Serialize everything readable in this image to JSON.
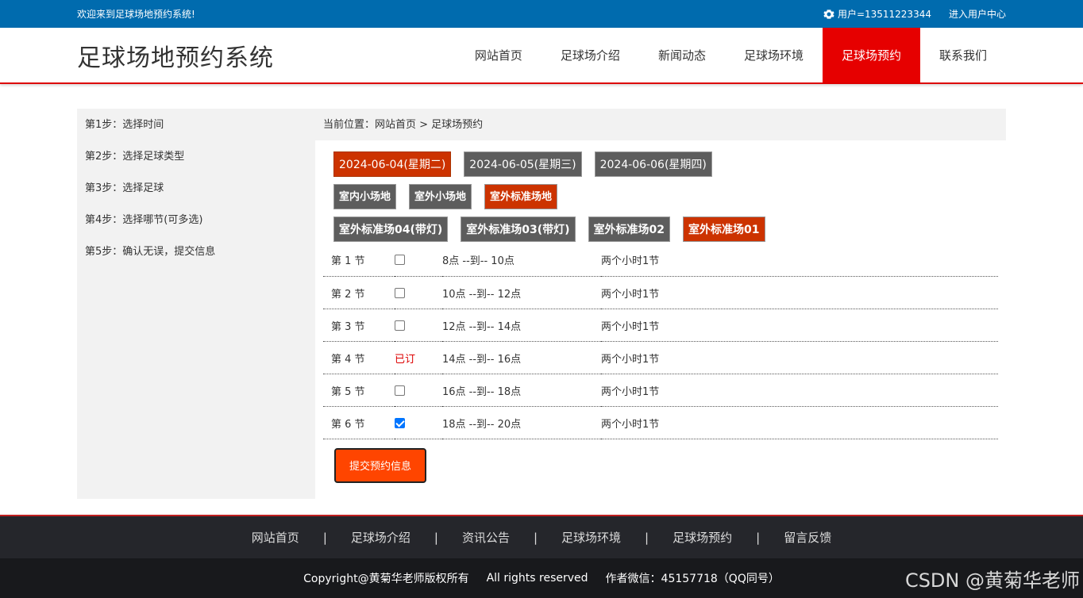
{
  "topbar": {
    "welcome": "欢迎来到足球场地预约系统!",
    "user": "用户=13511223344",
    "user_center": "进入用户中心"
  },
  "header": {
    "logo": "足球场地预约系统",
    "nav": [
      "网站首页",
      "足球场介绍",
      "新闻动态",
      "足球场环境",
      "足球场预约",
      "联系我们"
    ],
    "active_index": 4
  },
  "sidebar": {
    "steps": [
      "第1步：选择时间",
      "第2步：选择足球类型",
      "第3步：选择足球",
      "第4步：选择哪节(可多选)",
      "第5步：确认无误，提交信息"
    ]
  },
  "breadcrumb": "当前位置：网站首页 > 足球场预约",
  "dates": [
    {
      "label": "2024-06-04(星期二)",
      "selected": true
    },
    {
      "label": "2024-06-05(星期三)",
      "selected": false
    },
    {
      "label": "2024-06-06(星期四)",
      "selected": false
    }
  ],
  "types": [
    {
      "label": "室内小场地",
      "selected": false
    },
    {
      "label": "室外小场地",
      "selected": false
    },
    {
      "label": "室外标准场地",
      "selected": true
    }
  ],
  "fields": [
    {
      "label": "室外标准场04(带灯)",
      "selected": false
    },
    {
      "label": "室外标准场03(带灯)",
      "selected": false
    },
    {
      "label": "室外标准场02",
      "selected": false
    },
    {
      "label": "室外标准场01",
      "selected": true
    }
  ],
  "slots": [
    {
      "period": "第 1 节",
      "status": "checkbox",
      "checked": false,
      "time": "8点 --到-- 10点",
      "duration": "两个小时1节"
    },
    {
      "period": "第 2 节",
      "status": "checkbox",
      "checked": false,
      "time": "10点 --到-- 12点",
      "duration": "两个小时1节"
    },
    {
      "period": "第 3 节",
      "status": "checkbox",
      "checked": false,
      "time": "12点 --到-- 14点",
      "duration": "两个小时1节"
    },
    {
      "period": "第 4 节",
      "status": "booked",
      "booked_text": "已订",
      "time": "14点 --到-- 16点",
      "duration": "两个小时1节"
    },
    {
      "period": "第 5 节",
      "status": "checkbox",
      "checked": false,
      "time": "16点 --到-- 18点",
      "duration": "两个小时1节"
    },
    {
      "period": "第 6 节",
      "status": "checkbox",
      "checked": true,
      "time": "18点 --到-- 20点",
      "duration": "两个小时1节"
    }
  ],
  "submit_label": "提交预约信息",
  "footer": {
    "nav": [
      "网站首页",
      "足球场介绍",
      "资讯公告",
      "足球场环境",
      "足球场预约",
      "留言反馈"
    ],
    "separator": "|",
    "copyright": "Copyright@黄菊华老师版权所有",
    "rights": "All rights reserved",
    "contact": "作者微信：45157718（QQ同号）"
  },
  "watermark": "CSDN @黄菊华老师",
  "colors": {
    "topbar": "#006bae",
    "active_nav": "#e60000",
    "selected_button": "#cc3300",
    "submit": "#ff4500"
  }
}
